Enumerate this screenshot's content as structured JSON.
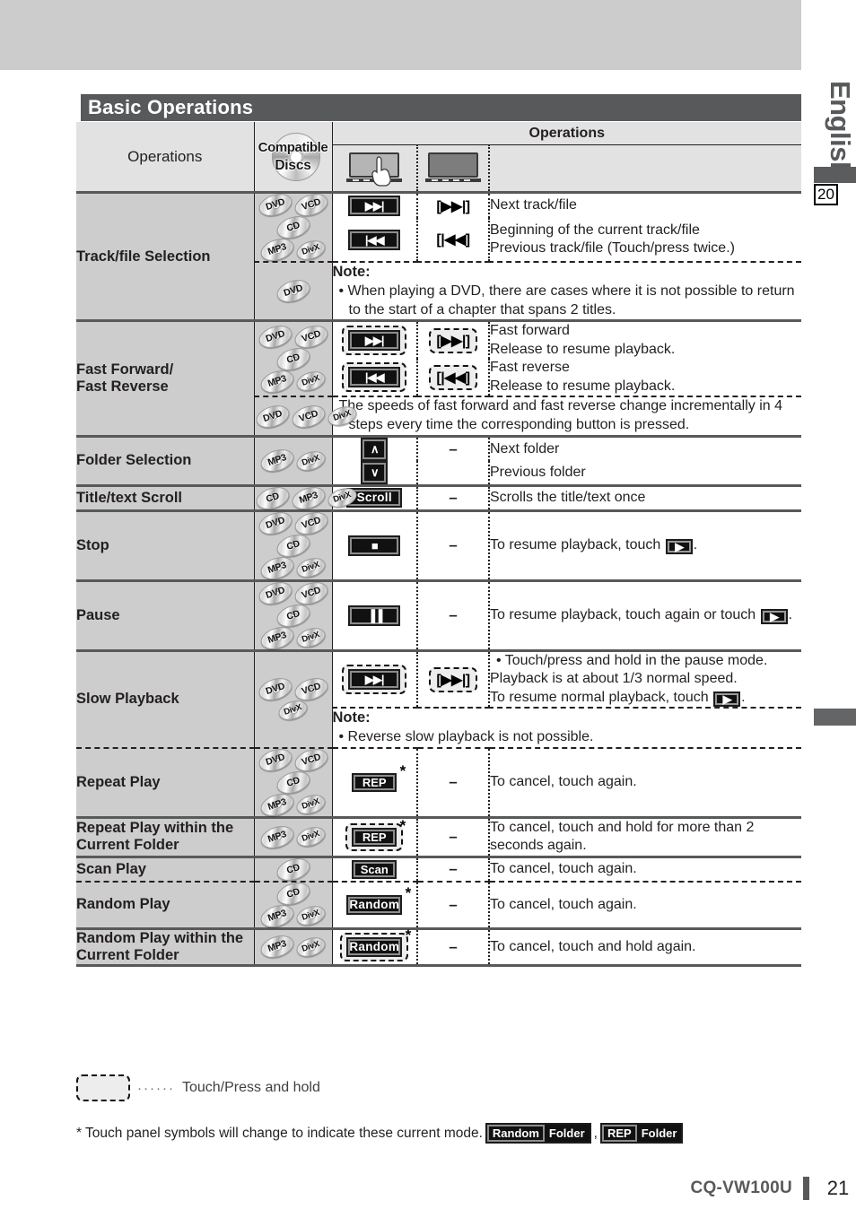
{
  "sidebar": {
    "language": "English",
    "prev_page_tab": "20"
  },
  "title": "Basic Operations",
  "table": {
    "header": {
      "operations": "Operations",
      "compatible_discs_line1": "Compatible",
      "compatible_discs_line2": "Discs",
      "operations_group": "Operations",
      "touch_panel_icon": "touch-panel-icon",
      "remote_icon": "remote-monitor-icon"
    },
    "rows": [
      {
        "name": "Track/file Selection",
        "discs": [
          [
            "DVD",
            "VCD"
          ],
          [
            "CD"
          ],
          [
            "MP3",
            "DivX"
          ]
        ],
        "items": [
          {
            "panel": "▶▶|",
            "panel_dashed": false,
            "remote": "[▶▶|]",
            "remote_dashed": false,
            "desc": "Next track/file"
          },
          {
            "panel": "|◀◀",
            "panel_dashed": false,
            "remote": "[|◀◀]",
            "remote_dashed": false,
            "desc": "Beginning of the current track/file\nPrevious track/file (Touch/press twice.)"
          }
        ],
        "note": {
          "discs": [
            [
              "DVD"
            ]
          ],
          "label": "Note:",
          "text": "When playing a DVD, there are cases where it is not possible to return to the start of a chapter that spans 2 titles."
        }
      },
      {
        "name": "Fast Forward/\nFast Reverse",
        "discs": [
          [
            "DVD",
            "VCD"
          ],
          [
            "CD"
          ],
          [
            "MP3",
            "DivX"
          ]
        ],
        "items": [
          {
            "panel": "▶▶|",
            "panel_dashed": true,
            "remote": "[▶▶|]",
            "remote_dashed": true,
            "desc": "Fast forward\nRelease to resume playback."
          },
          {
            "panel": "|◀◀",
            "panel_dashed": true,
            "remote": "[|◀◀]",
            "remote_dashed": true,
            "desc": "Fast reverse\nRelease to resume playback."
          }
        ],
        "note": {
          "discs": [
            [
              "DVD",
              "VCD",
              "DivX"
            ]
          ],
          "label": "",
          "text": "The speeds of fast forward and fast reverse change incrementally in 4 steps every time the corresponding button is pressed."
        }
      },
      {
        "name": "Folder Selection",
        "discs": [
          [
            "MP3",
            "DivX"
          ]
        ],
        "items": [
          {
            "panel": "∧",
            "panel_dashed": false,
            "remote": "–",
            "remote_dashed": false,
            "desc": "Next folder"
          },
          {
            "panel": "∨",
            "panel_dashed": false,
            "remote": "",
            "remote_dashed": false,
            "desc": "Previous folder"
          }
        ]
      },
      {
        "name": "Title/text Scroll",
        "discs": [
          [
            "CD",
            "MP3",
            "DivX"
          ]
        ],
        "items": [
          {
            "panel": "Scroll",
            "panel_text": true,
            "panel_dashed": false,
            "remote": "–",
            "remote_dashed": false,
            "desc": "Scrolls the title/text once"
          }
        ]
      },
      {
        "name": "Stop",
        "discs": [
          [
            "DVD",
            "VCD"
          ],
          [
            "CD"
          ],
          [
            "MP3",
            "DivX"
          ]
        ],
        "items": [
          {
            "panel": "■",
            "panel_dashed": false,
            "remote": "–",
            "remote_dashed": false,
            "desc": "To resume playback, touch [PLAY]."
          }
        ]
      },
      {
        "name": "Pause",
        "discs": [
          [
            "DVD",
            "VCD"
          ],
          [
            "CD"
          ],
          [
            "MP3",
            "DivX"
          ]
        ],
        "items": [
          {
            "panel": "▐▐",
            "panel_dashed": false,
            "remote": "–",
            "remote_dashed": false,
            "desc": "To resume playback, touch again or touch [PLAY]."
          }
        ]
      },
      {
        "name": "Slow Playback",
        "discs": [
          [
            "DVD",
            "VCD"
          ],
          [
            "DivX"
          ]
        ],
        "items": [
          {
            "panel": "▶▶|",
            "panel_dashed": true,
            "remote": "[▶▶|]",
            "remote_dashed": true,
            "desc": "Touch/press and hold in the pause mode.\nPlayback is at about 1/3 normal speed.\nTo resume normal playback, touch [PLAY]."
          }
        ],
        "note": {
          "label": "Note:",
          "text": "Reverse slow playback is not possible."
        }
      },
      {
        "name": "Repeat Play",
        "discs": [
          [
            "DVD",
            "VCD"
          ],
          [
            "CD"
          ],
          [
            "MP3",
            "DivX"
          ]
        ],
        "items": [
          {
            "panel": "REP",
            "panel_text": true,
            "panel_dashed": false,
            "star": true,
            "remote": "–",
            "remote_dashed": false,
            "desc": "To cancel, touch again."
          }
        ]
      },
      {
        "name": "Repeat Play within the\nCurrent Folder",
        "discs": [
          [
            "MP3",
            "DivX"
          ]
        ],
        "items": [
          {
            "panel": "REP",
            "panel_text": true,
            "panel_dashed": true,
            "star": true,
            "remote": "–",
            "remote_dashed": false,
            "desc": "To cancel, touch and hold for more than 2 seconds again."
          }
        ]
      },
      {
        "name": "Scan Play",
        "discs": [
          [
            "CD"
          ]
        ],
        "items": [
          {
            "panel": "Scan",
            "panel_text": true,
            "panel_dashed": false,
            "remote": "–",
            "remote_dashed": false,
            "desc": "To cancel, touch again."
          }
        ]
      },
      {
        "name": "Random Play",
        "discs": [
          [
            "CD"
          ],
          [
            "MP3",
            "DivX"
          ]
        ],
        "items": [
          {
            "panel": "Random",
            "panel_text": true,
            "panel_dashed": false,
            "star": true,
            "remote": "–",
            "remote_dashed": false,
            "desc": "To cancel, touch again."
          }
        ]
      },
      {
        "name": "Random Play within the\nCurrent Folder",
        "discs": [
          [
            "MP3",
            "DivX"
          ]
        ],
        "items": [
          {
            "panel": "Random",
            "panel_text": true,
            "panel_dashed": true,
            "star": true,
            "remote": "–",
            "remote_dashed": false,
            "desc": "To cancel, touch and hold again."
          }
        ]
      }
    ]
  },
  "legend": {
    "dots": "······",
    "text": "Touch/Press and hold"
  },
  "footnote": {
    "text": "* Touch panel symbols will change to indicate these current mode.",
    "badge1_a": "Random",
    "badge1_b": "Folder",
    "separator": ",",
    "badge2_a": "REP",
    "badge2_b": "Folder"
  },
  "footer": {
    "model": "CQ-VW100U",
    "page": "21"
  },
  "colors": {
    "title_bar": "#58595b",
    "header_bg": "#e2e2e2",
    "row_label_bg": "#cdcdcd",
    "top_band": "#cccccc"
  }
}
